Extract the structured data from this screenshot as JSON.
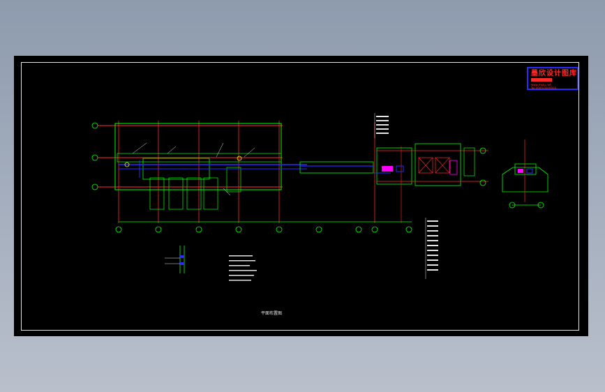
{
  "stamp": {
    "title": "墨欣设计图库",
    "line1": "www.mxtu.net",
    "line2": "Tel:0000-0000000"
  },
  "drawing": {
    "caption": "平面布置图"
  },
  "colors": {
    "background": "#000000",
    "grid": "#ff2a2a",
    "outline": "#00ff00",
    "pipe": "#2a2aff",
    "text": "#e6e6e6",
    "stamp_border": "#2a2aff",
    "stamp_text": "#ff2a2a"
  }
}
